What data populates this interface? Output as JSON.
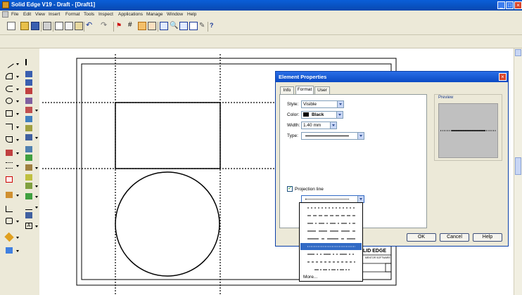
{
  "window": {
    "title": "Solid Edge V19 - Draft - [Draft1]",
    "min": "_",
    "max": "□",
    "close": "×"
  },
  "menu": [
    "File",
    "Edit",
    "View",
    "Insert",
    "Format",
    "Tools",
    "Inspect",
    "Applications",
    "Manage",
    "Window",
    "Help"
  ],
  "dialog": {
    "title": "Element Properties",
    "close": "×",
    "tabs": [
      "Info",
      "Format",
      "User"
    ],
    "active_tab": "Format",
    "fields": {
      "style_label": "Style:",
      "style_value": "Visible",
      "color_label": "Color:",
      "color_value": "Black",
      "width_label": "Width:",
      "width_value": "1.40 mm",
      "type_label": "Type:"
    },
    "projection_label": "Projection line",
    "preview_label": "Preview",
    "buttons": {
      "ok": "OK",
      "cancel": "Cancel",
      "help": "Help"
    },
    "dropdown": {
      "more": "More...",
      "selected_index": 6
    }
  },
  "titleblock": {
    "text": "LID EDGE",
    "small": "MENTOR SOFTWARE"
  },
  "colors": {
    "titlebar": "#0a5fd8",
    "selection": "#316ac5",
    "accent_line": "#000000"
  },
  "icons": [
    "new",
    "open",
    "save",
    "print",
    "cut",
    "copy",
    "paste",
    "undo",
    "redo",
    "select",
    "grid",
    "zoom",
    "fit",
    "help"
  ]
}
